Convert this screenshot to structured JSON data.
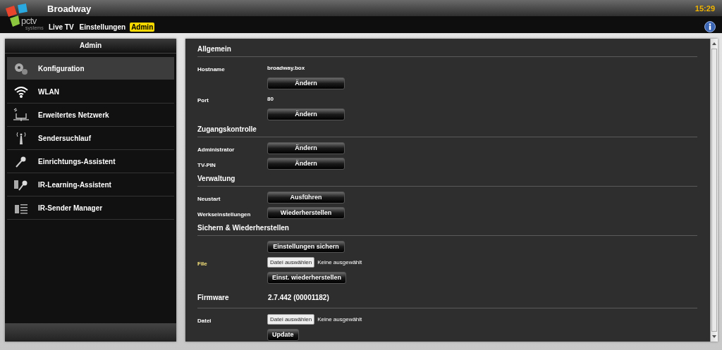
{
  "header": {
    "logo_text": "pctv",
    "logo_subtext": "systems",
    "title": "Broadway",
    "clock": "15:29",
    "nav": [
      {
        "label": "Live TV",
        "selected": false
      },
      {
        "label": "Einstellungen",
        "selected": false
      },
      {
        "label": "Admin",
        "selected": true
      }
    ]
  },
  "sidebar": {
    "title": "Admin",
    "items": [
      {
        "label": "Konfiguration",
        "kind": "gears",
        "selected": true
      },
      {
        "label": "WLAN",
        "kind": "wifi",
        "selected": false
      },
      {
        "label": "Erweitertes Netzwerk",
        "kind": "network",
        "selected": false
      },
      {
        "label": "Sendersuchlauf",
        "kind": "antenna",
        "selected": false
      },
      {
        "label": "Einrichtungs-Assistent",
        "kind": "wand",
        "selected": false
      },
      {
        "label": "IR-Learning-Assistent",
        "kind": "remote-wand",
        "selected": false
      },
      {
        "label": "IR-Sender Manager",
        "kind": "remote-list",
        "selected": false
      }
    ]
  },
  "sections": [
    {
      "title": "Allgemein",
      "kind": "heading",
      "rows": [
        {
          "kind": "value",
          "label": "Hostname",
          "value": "broadway.box"
        },
        {
          "kind": "button",
          "button": "Ändern",
          "wide": true
        },
        {
          "kind": "value",
          "label": "Port",
          "value": "80"
        },
        {
          "kind": "button",
          "button": "Ändern",
          "wide": true
        }
      ]
    },
    {
      "title": "Zugangskontrolle",
      "kind": "heading",
      "rows": [
        {
          "kind": "button",
          "label": "Administrator",
          "button": "Ändern",
          "wide": true
        },
        {
          "kind": "button",
          "label": "TV-PIN",
          "button": "Ändern",
          "wide": true
        }
      ]
    },
    {
      "title": "Verwaltung",
      "kind": "heading",
      "rows": [
        {
          "kind": "button",
          "label": "Neustart",
          "button": "Ausführen",
          "wide": true
        },
        {
          "kind": "button",
          "label": "Werkseinstellungen",
          "button": "Wiederherstellen",
          "wide": true
        }
      ]
    },
    {
      "title": "Sichern & Wiederherstellen",
      "kind": "heading",
      "rows": [
        {
          "kind": "button",
          "button": "Einstellungen sichern",
          "wide": true
        },
        {
          "kind": "file",
          "label": "File",
          "button": "Datei auswählen",
          "status": "Keine ausgewählt",
          "highlight": true
        },
        {
          "kind": "button",
          "button": "Einst. wiederherstellen",
          "wide": false
        }
      ]
    },
    {
      "title": "Firmware",
      "kind": "value-heading",
      "value": "2.7.442 (00001182)",
      "rows": [
        {
          "kind": "file",
          "label": "Datei",
          "button": "Datei auswählen",
          "status": "Keine ausgewählt",
          "highlight": false
        },
        {
          "kind": "button",
          "button": "Update",
          "wide": false
        }
      ]
    }
  ]
}
